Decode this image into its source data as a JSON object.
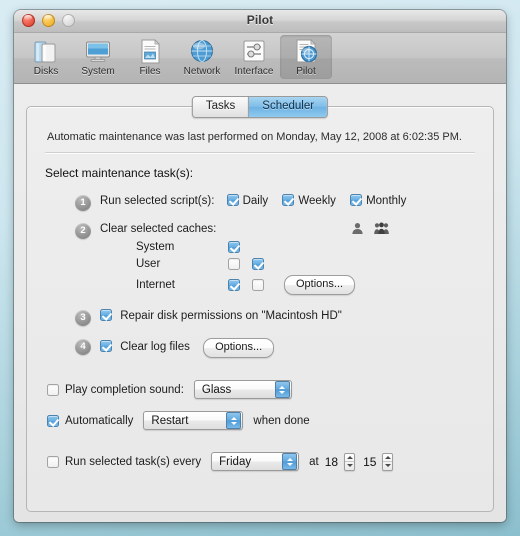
{
  "window": {
    "title": "Pilot",
    "controls": {
      "close": "close-button",
      "minimize": "minimize-button",
      "zoom": "zoom-button"
    }
  },
  "toolbar": {
    "items": [
      {
        "label": "Disks",
        "icon": "disks-icon",
        "selected": false
      },
      {
        "label": "System",
        "icon": "system-icon",
        "selected": false
      },
      {
        "label": "Files",
        "icon": "files-icon",
        "selected": false
      },
      {
        "label": "Network",
        "icon": "network-icon",
        "selected": false
      },
      {
        "label": "Interface",
        "icon": "interface-icon",
        "selected": false
      },
      {
        "label": "Pilot",
        "icon": "pilot-icon",
        "selected": true
      }
    ]
  },
  "tabs": [
    {
      "label": "Tasks",
      "active": false
    },
    {
      "label": "Scheduler",
      "active": true
    }
  ],
  "status": {
    "message": "Automatic maintenance was last performed on Monday, May 12, 2008 at 6:02:35 PM."
  },
  "main": {
    "section_title": "Select maintenance task(s):",
    "step1": {
      "number": "1",
      "label": "Run selected script(s):",
      "options": [
        {
          "label": "Daily",
          "checked": true
        },
        {
          "label": "Weekly",
          "checked": true
        },
        {
          "label": "Monthly",
          "checked": true
        }
      ]
    },
    "step2": {
      "number": "2",
      "label": "Clear selected caches:",
      "column_icons": [
        "user-single-icon",
        "user-group-icon"
      ],
      "rows": [
        {
          "name": "System",
          "col1": true,
          "col2": null,
          "button": null
        },
        {
          "name": "User",
          "col1": false,
          "col2": true,
          "button": null
        },
        {
          "name": "Internet",
          "col1": true,
          "col2": false,
          "button": "Options..."
        }
      ]
    },
    "step3": {
      "number": "3",
      "label": "Repair disk permissions on \"Macintosh HD\"",
      "checked": true
    },
    "step4": {
      "number": "4",
      "label": "Clear log files",
      "checked": true,
      "button": "Options..."
    }
  },
  "footer": {
    "sound": {
      "label": "Play completion sound:",
      "checked": false,
      "value": "Glass"
    },
    "automatic": {
      "label": "Automatically",
      "checked": true,
      "value": "Restart",
      "suffix": "when done"
    },
    "schedule": {
      "label": "Run selected task(s) every",
      "checked": false,
      "day": "Friday",
      "at_label": "at",
      "hour": "18",
      "minute": "15"
    }
  },
  "colors": {
    "accent_blue": "#539fdb",
    "tab_active": "#7fbde8",
    "desktop": "#a9d2dd"
  }
}
